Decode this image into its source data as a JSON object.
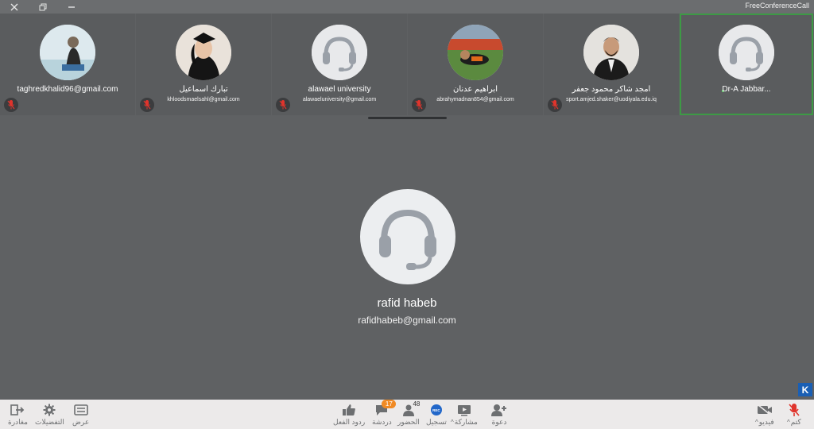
{
  "window": {
    "app_name": "FreeConferenceCall",
    "buttons": [
      "close",
      "restore",
      "minimize"
    ]
  },
  "participants": [
    {
      "name": "taghredkhalid96@gmail.com",
      "email": "",
      "avatar": "photo",
      "muted": true
    },
    {
      "name": "تبارك اسماعيل",
      "email": "khloodsmaelsahl@gmail.com",
      "avatar": "photo",
      "muted": true
    },
    {
      "name": "alawael university",
      "email": "alawaeluniversity@gmail.com",
      "avatar": "headset-icon",
      "muted": true
    },
    {
      "name": "ابراهيم عدنان",
      "email": "abrahymadnan854@gmail.com",
      "avatar": "photo",
      "muted": true
    },
    {
      "name": "امجد شاكر محمود جعفر",
      "email": "sport.amjed.shaker@uodiyala.edu.iq",
      "avatar": "photo",
      "muted": true
    },
    {
      "name": "Dr-A Jabbar...",
      "email": "",
      "avatar": "headset-icon",
      "muted": false,
      "active": true
    }
  ],
  "main_speaker": {
    "name": "rafid habeb",
    "email": "rafidhabeb@gmail.com",
    "avatar": "headset-icon"
  },
  "toolbar": {
    "left": [
      {
        "id": "leave",
        "label": "مغادرة",
        "icon": "exit-icon"
      },
      {
        "id": "settings",
        "label": "التفضيلات",
        "icon": "gear-icon"
      },
      {
        "id": "view",
        "label": "عرض",
        "icon": "grid-icon"
      }
    ],
    "center": [
      {
        "id": "reactions",
        "label": "ردود الفعل",
        "icon": "thumbs-up-icon"
      },
      {
        "id": "chat",
        "label": "دردشة",
        "icon": "chat-icon",
        "badge": "17"
      },
      {
        "id": "attendance",
        "label": "الحضور",
        "icon": "people-icon",
        "badge": "48"
      },
      {
        "id": "record",
        "label": "تسجيل",
        "icon": "record-icon",
        "badge": "REC"
      },
      {
        "id": "share",
        "label": "مشاركة",
        "icon": "screen-share-icon"
      },
      {
        "id": "invite",
        "label": "دعوة",
        "icon": "add-person-icon"
      }
    ],
    "right": [
      {
        "id": "video",
        "label": "فيديو",
        "icon": "camera-icon"
      },
      {
        "id": "mute",
        "label": "كتم",
        "icon": "microphone-muted-icon"
      }
    ]
  },
  "k_badge": "K",
  "colors": {
    "background": "#5f6163",
    "active_border": "#3d9a45",
    "muted_red": "#e0342c",
    "chat_badge": "#f08a24",
    "record_blue": "#2267c9"
  }
}
